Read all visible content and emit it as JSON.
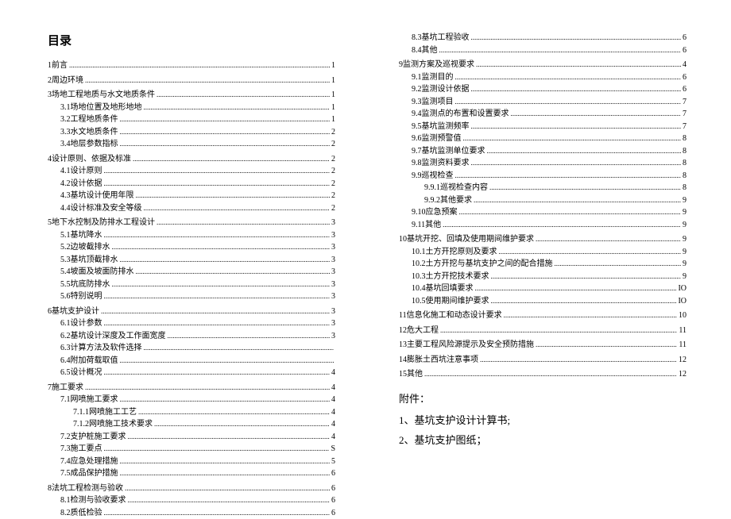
{
  "title": "目录",
  "appendix": {
    "title": "附件：",
    "items": [
      "1、基坑支护设计计算书;",
      "2、基坑支护图纸；"
    ]
  },
  "toc": [
    {
      "type": "main",
      "num": "1",
      "label": "前言",
      "page": "1"
    },
    {
      "type": "main",
      "num": "2",
      "label": "周边环境",
      "page": "1"
    },
    {
      "type": "main",
      "num": "3",
      "label": "场地工程地质与水文地质条件",
      "page": "1"
    },
    {
      "type": "sub",
      "num": "3.1",
      "label": "场地位置及地形地地",
      "page": "1"
    },
    {
      "type": "sub",
      "num": "3.2",
      "label": "工程地质条件",
      "page": "1"
    },
    {
      "type": "sub",
      "num": "3.3",
      "label": "水文地质条件",
      "page": "2"
    },
    {
      "type": "sub",
      "num": "3.4",
      "label": "地层参数指标",
      "page": "2"
    },
    {
      "type": "main",
      "num": "4",
      "label": "设计原则、依据及标准",
      "page": "2"
    },
    {
      "type": "sub",
      "num": "4.1",
      "label": "设计原则",
      "page": "2"
    },
    {
      "type": "sub",
      "num": "4.2",
      "label": "设计依据",
      "page": "2"
    },
    {
      "type": "sub",
      "num": "4.3",
      "label": "基坑设计使用年限",
      "page": "2"
    },
    {
      "type": "sub",
      "num": "4.4",
      "label": "设计标准及安全等级",
      "page": "2"
    },
    {
      "type": "main",
      "num": "5",
      "label": "地下水控制及防排水工程设计",
      "page": "3"
    },
    {
      "type": "sub",
      "num": "5.1",
      "label": "基坑降水",
      "page": "3"
    },
    {
      "type": "sub",
      "num": "5.2",
      "label": "边坡截排水",
      "page": "3"
    },
    {
      "type": "sub",
      "num": "5.3",
      "label": "基坑顶截排水",
      "page": "3"
    },
    {
      "type": "sub",
      "num": "5.4",
      "label": "坡面及坡面防排水",
      "page": "3"
    },
    {
      "type": "sub",
      "num": "5.5",
      "label": "坑底防排水",
      "page": "3"
    },
    {
      "type": "sub",
      "num": "5.6",
      "label": "特别说明",
      "page": "3"
    },
    {
      "type": "main",
      "num": "6",
      "label": "基坑支护设计",
      "page": "3"
    },
    {
      "type": "sub",
      "num": "6.1",
      "label": "设计参数",
      "page": "3"
    },
    {
      "type": "sub",
      "num": "6.2",
      "label": "基坑设计深度及工作面宽度",
      "page": "3"
    },
    {
      "type": "sub",
      "num": "6.3",
      "label": "计算方法及软件选择",
      "page": ""
    },
    {
      "type": "sub",
      "num": "6.4",
      "label": "附加荷载取值",
      "page": ""
    },
    {
      "type": "sub",
      "num": "6.5",
      "label": "设计概况",
      "page": "4"
    },
    {
      "type": "main",
      "num": "7",
      "label": "施工要求",
      "page": "4"
    },
    {
      "type": "sub",
      "num": "7.1",
      "label": "网喷施工要求",
      "page": "4"
    },
    {
      "type": "sub2",
      "num": "7.1.1",
      "label": "网喷施工工艺",
      "page": "4"
    },
    {
      "type": "sub2",
      "num": "7.1.2",
      "label": "网喷施工技术要求",
      "page": "4"
    },
    {
      "type": "sub",
      "num": "7.2",
      "label": "支护桩施工要求",
      "page": "4"
    },
    {
      "type": "sub",
      "num": "7.3",
      "label": "施工要点",
      "page": "S"
    },
    {
      "type": "sub",
      "num": "7.4",
      "label": "应急处理措施",
      "page": "5"
    },
    {
      "type": "sub",
      "num": "7.5",
      "label": "成品保护措施",
      "page": "6"
    },
    {
      "type": "main",
      "num": "8",
      "label": "法坑工程检测与验收",
      "page": "6"
    },
    {
      "type": "sub",
      "num": "8.1",
      "label": "检测与验收要求",
      "page": "6"
    },
    {
      "type": "sub",
      "num": "8.2",
      "label": "质低检验",
      "page": "6"
    }
  ],
  "toc_right": [
    {
      "type": "sub",
      "num": "8.3",
      "label": "基坑工程验收",
      "page": "6"
    },
    {
      "type": "sub",
      "num": "8.4",
      "label": "其他",
      "page": "6"
    },
    {
      "type": "main",
      "num": "9",
      "label": "监测方案及巡视要求",
      "page": "4"
    },
    {
      "type": "sub",
      "num": "9.1",
      "label": "监测目的",
      "page": "6"
    },
    {
      "type": "sub",
      "num": "9.2",
      "label": "监测设计依据",
      "page": "6"
    },
    {
      "type": "sub",
      "num": "9.3",
      "label": "监测项目",
      "page": "7"
    },
    {
      "type": "sub",
      "num": "9.4",
      "label": "监测点的布置和设置要求",
      "page": "7"
    },
    {
      "type": "sub",
      "num": "9.5",
      "label": "基坑监测频率",
      "page": "7"
    },
    {
      "type": "sub",
      "num": "9.6",
      "label": "监测预警值",
      "page": "8"
    },
    {
      "type": "sub",
      "num": "9.7",
      "label": "基坑监测单位要求",
      "page": "8"
    },
    {
      "type": "sub",
      "num": "9.8",
      "label": "监测资料要求",
      "page": "8"
    },
    {
      "type": "sub",
      "num": "9.9",
      "label": "巡视检查",
      "page": "8"
    },
    {
      "type": "sub2",
      "num": "9.9.1",
      "label": "巡视检查内容",
      "page": "8"
    },
    {
      "type": "sub2",
      "num": "9.9.2",
      "label": "其他要求",
      "page": "9"
    },
    {
      "type": "sub",
      "num": "9.10",
      "label": "应急预案",
      "page": "9"
    },
    {
      "type": "sub",
      "num": "9.11",
      "label": "其他",
      "page": "9"
    },
    {
      "type": "main",
      "num": "10",
      "label": "基坑开挖、回填及使用期间维护要求",
      "page": "9"
    },
    {
      "type": "sub",
      "num": "10.1",
      "label": "土方开挖原则及要求",
      "page": "9"
    },
    {
      "type": "sub",
      "num": "10.2",
      "label": "土方开挖与基坑支护之间的配合措施",
      "page": "9"
    },
    {
      "type": "sub",
      "num": "10.3",
      "label": "土方开挖技术要求",
      "page": "9"
    },
    {
      "type": "sub",
      "num": "10.4",
      "label": "基坑回填要求",
      "page": "IO"
    },
    {
      "type": "sub",
      "num": "10.5",
      "label": "使用期间维护要求",
      "page": "IO"
    },
    {
      "type": "main",
      "num": "11",
      "label": "信息化施工和动态设计要求",
      "page": "10"
    },
    {
      "type": "main",
      "num": "12",
      "label": "危大工程",
      "page": "11"
    },
    {
      "type": "main",
      "num": "13",
      "label": "主要工程风险源提示及安全预防措施",
      "page": "11"
    },
    {
      "type": "main",
      "num": "14",
      "label": "膨胀土西坑注意事项",
      "page": "12"
    },
    {
      "type": "main",
      "num": "15",
      "label": "其他",
      "page": "12"
    }
  ]
}
